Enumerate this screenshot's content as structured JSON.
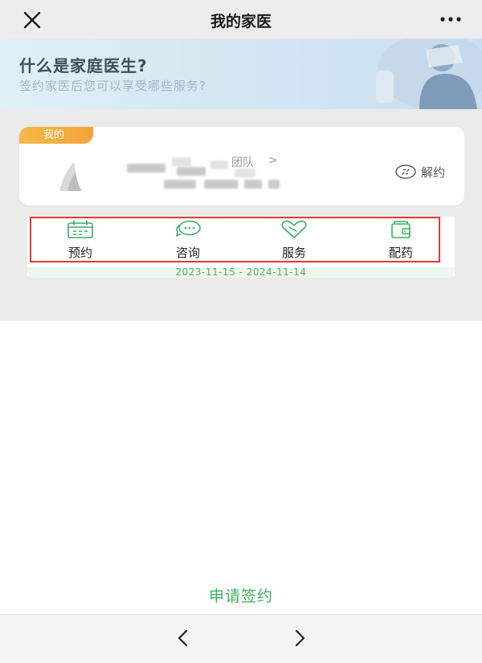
{
  "navbar": {
    "title": "我的家医",
    "close_icon": "close-icon",
    "more_icon": "more-dots-icon"
  },
  "banner": {
    "title": "什么是家庭医生?",
    "subtitle": "签约家医后您可以享受哪些服务?"
  },
  "doctor_card": {
    "tag": "我的",
    "team_label": "团队",
    "team_arrow": ">",
    "cancel_label": "解约",
    "cancel_icon": "unlink-icon"
  },
  "services": [
    {
      "label": "预约",
      "icon": "calendar-icon"
    },
    {
      "label": "咨询",
      "icon": "chat-bubble-icon"
    },
    {
      "label": "服务",
      "icon": "heart-icon"
    },
    {
      "label": "配药",
      "icon": "wallet-icon"
    }
  ],
  "contract_period": "2023-11-15 - 2024-11-14",
  "apply_label": "申请签约",
  "bottom_bar": {
    "back_icon": "chevron-left-icon",
    "forward_icon": "chevron-right-icon"
  },
  "colors": {
    "accent_green": "#3fae5e",
    "tag_orange": "#f6a23a",
    "highlight_red": "#e03a33"
  }
}
